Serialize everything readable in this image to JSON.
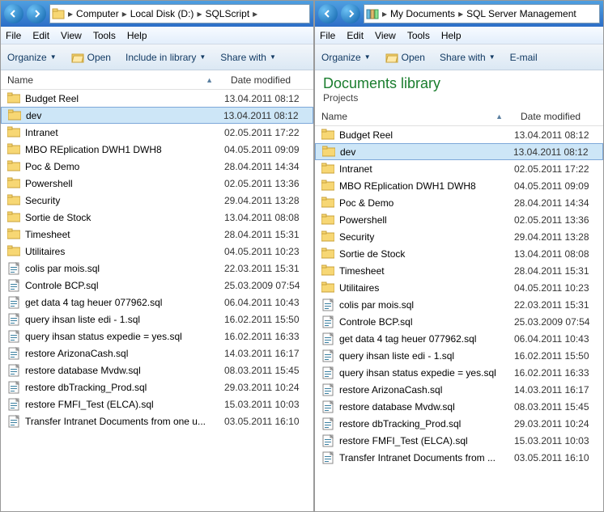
{
  "left": {
    "breadcrumb": [
      "Computer",
      "Local Disk (D:)",
      "SQLScript"
    ],
    "menu": {
      "file": "File",
      "edit": "Edit",
      "view": "View",
      "tools": "Tools",
      "help": "Help"
    },
    "toolbar": {
      "organize": "Organize",
      "open": "Open",
      "include": "Include in library",
      "share": "Share with"
    },
    "cols": {
      "name": "Name",
      "date": "Date modified"
    },
    "items": [
      {
        "n": "Budget Reel",
        "d": "13.04.2011 08:12",
        "t": "folder"
      },
      {
        "n": "dev",
        "d": "13.04.2011 08:12",
        "t": "folder",
        "sel": true
      },
      {
        "n": "Intranet",
        "d": "02.05.2011 17:22",
        "t": "folder"
      },
      {
        "n": "MBO REplication DWH1 DWH8",
        "d": "04.05.2011 09:09",
        "t": "folder"
      },
      {
        "n": "Poc & Demo",
        "d": "28.04.2011 14:34",
        "t": "folder"
      },
      {
        "n": "Powershell",
        "d": "02.05.2011 13:36",
        "t": "folder"
      },
      {
        "n": "Security",
        "d": "29.04.2011 13:28",
        "t": "folder"
      },
      {
        "n": "Sortie de Stock",
        "d": "13.04.2011 08:08",
        "t": "folder"
      },
      {
        "n": "Timesheet",
        "d": "28.04.2011 15:31",
        "t": "folder"
      },
      {
        "n": "Utilitaires",
        "d": "04.05.2011 10:23",
        "t": "folder"
      },
      {
        "n": "colis par mois.sql",
        "d": "22.03.2011 15:31",
        "t": "sql"
      },
      {
        "n": "Controle BCP.sql",
        "d": "25.03.2009 07:54",
        "t": "sql"
      },
      {
        "n": "get data 4 tag heuer 077962.sql",
        "d": "06.04.2011 10:43",
        "t": "sql"
      },
      {
        "n": "query ihsan liste edi - 1.sql",
        "d": "16.02.2011 15:50",
        "t": "sql"
      },
      {
        "n": "query ihsan status expedie = yes.sql",
        "d": "16.02.2011 16:33",
        "t": "sql"
      },
      {
        "n": "restore ArizonaCash.sql",
        "d": "14.03.2011 16:17",
        "t": "sql"
      },
      {
        "n": "restore database Mvdw.sql",
        "d": "08.03.2011 15:45",
        "t": "sql"
      },
      {
        "n": "restore dbTracking_Prod.sql",
        "d": "29.03.2011 10:24",
        "t": "sql"
      },
      {
        "n": "restore FMFI_Test (ELCA).sql",
        "d": "15.03.2011 10:03",
        "t": "sql"
      },
      {
        "n": "Transfer Intranet Documents from one u...",
        "d": "03.05.2011 16:10",
        "t": "sql"
      }
    ]
  },
  "right": {
    "breadcrumb": [
      "My Documents",
      "SQL Server Management"
    ],
    "menu": {
      "file": "File",
      "edit": "Edit",
      "view": "View",
      "tools": "Tools",
      "help": "Help"
    },
    "toolbar": {
      "organize": "Organize",
      "open": "Open",
      "share": "Share with",
      "email": "E-mail"
    },
    "library": {
      "title": "Documents library",
      "sub": "Projects"
    },
    "cols": {
      "name": "Name",
      "date": "Date modified"
    },
    "items": [
      {
        "n": "Budget Reel",
        "d": "13.04.2011 08:12",
        "t": "folder"
      },
      {
        "n": "dev",
        "d": "13.04.2011 08:12",
        "t": "folder",
        "sel": true
      },
      {
        "n": "Intranet",
        "d": "02.05.2011 17:22",
        "t": "folder"
      },
      {
        "n": "MBO REplication DWH1 DWH8",
        "d": "04.05.2011 09:09",
        "t": "folder"
      },
      {
        "n": "Poc & Demo",
        "d": "28.04.2011 14:34",
        "t": "folder"
      },
      {
        "n": "Powershell",
        "d": "02.05.2011 13:36",
        "t": "folder"
      },
      {
        "n": "Security",
        "d": "29.04.2011 13:28",
        "t": "folder"
      },
      {
        "n": "Sortie de Stock",
        "d": "13.04.2011 08:08",
        "t": "folder"
      },
      {
        "n": "Timesheet",
        "d": "28.04.2011 15:31",
        "t": "folder"
      },
      {
        "n": "Utilitaires",
        "d": "04.05.2011 10:23",
        "t": "folder"
      },
      {
        "n": "colis par mois.sql",
        "d": "22.03.2011 15:31",
        "t": "sql"
      },
      {
        "n": "Controle BCP.sql",
        "d": "25.03.2009 07:54",
        "t": "sql"
      },
      {
        "n": "get data 4 tag heuer 077962.sql",
        "d": "06.04.2011 10:43",
        "t": "sql"
      },
      {
        "n": "query ihsan liste edi - 1.sql",
        "d": "16.02.2011 15:50",
        "t": "sql"
      },
      {
        "n": "query ihsan status expedie = yes.sql",
        "d": "16.02.2011 16:33",
        "t": "sql"
      },
      {
        "n": "restore ArizonaCash.sql",
        "d": "14.03.2011 16:17",
        "t": "sql"
      },
      {
        "n": "restore database Mvdw.sql",
        "d": "08.03.2011 15:45",
        "t": "sql"
      },
      {
        "n": "restore dbTracking_Prod.sql",
        "d": "29.03.2011 10:24",
        "t": "sql"
      },
      {
        "n": "restore FMFI_Test (ELCA).sql",
        "d": "15.03.2011 10:03",
        "t": "sql"
      },
      {
        "n": "Transfer Intranet Documents from ...",
        "d": "03.05.2011 16:10",
        "t": "sql"
      }
    ]
  }
}
